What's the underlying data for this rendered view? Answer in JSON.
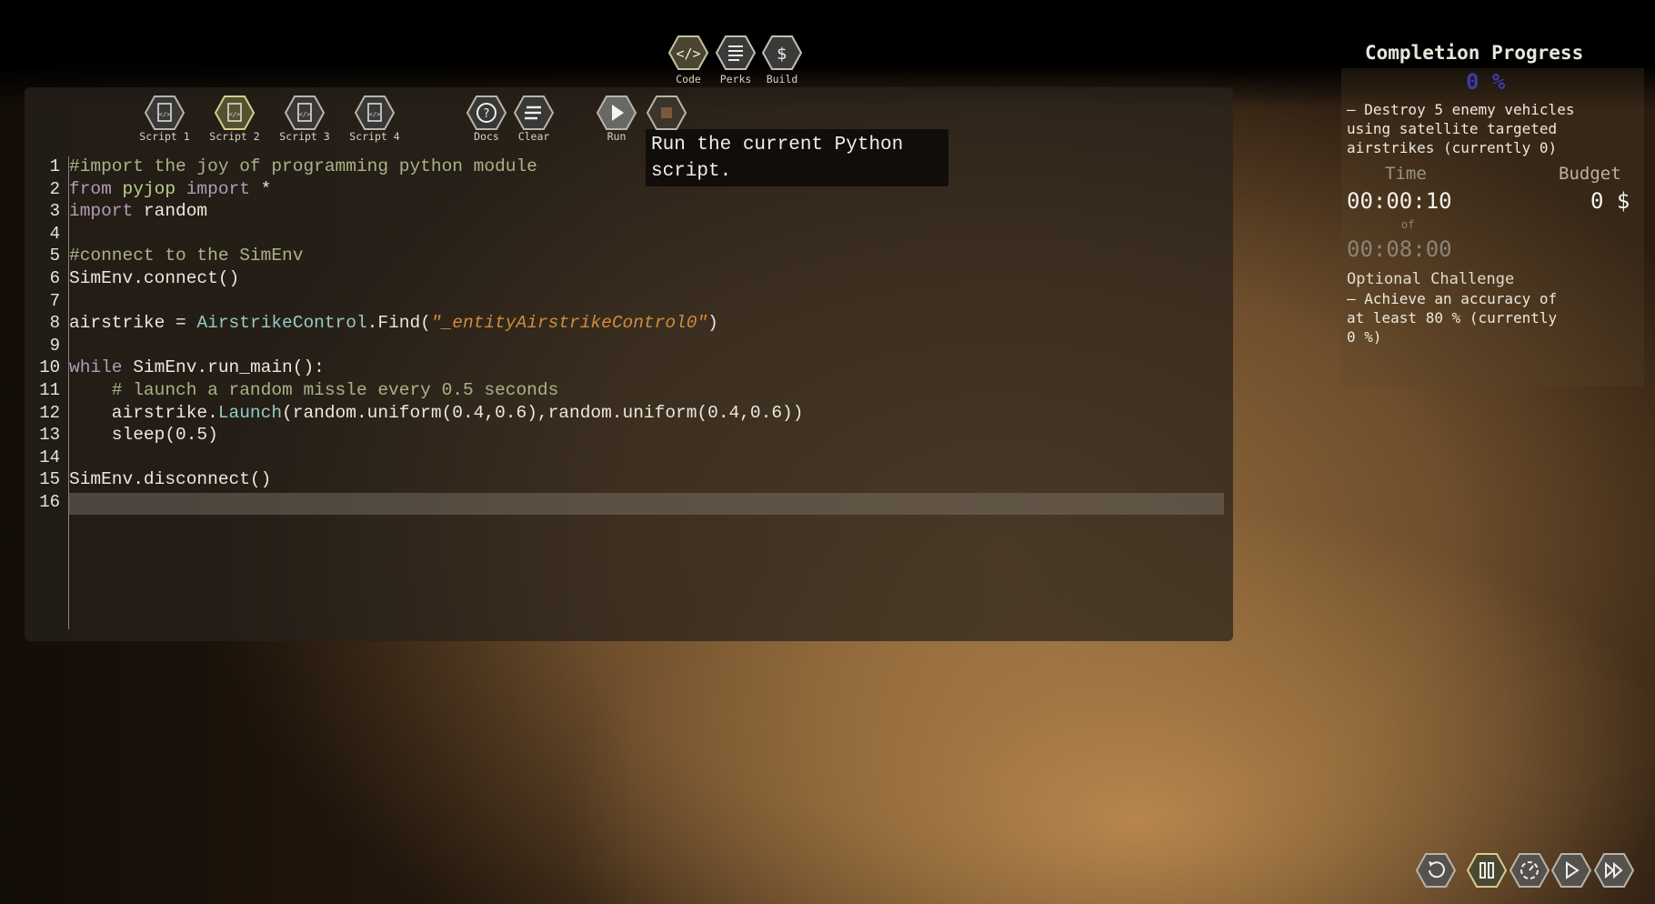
{
  "colors": {
    "accent_progress": "#3f3aa8",
    "comment": "#a9b486",
    "keyword": "#b49ab8",
    "class": "#93cbc3",
    "string": "#d08c3c"
  },
  "top_nav": [
    {
      "label": "Code",
      "icon": "code-icon"
    },
    {
      "label": "Perks",
      "icon": "list-icon"
    },
    {
      "label": "Build",
      "icon": "dollar-icon"
    }
  ],
  "toolbar": {
    "scripts": [
      {
        "label": "Script 1",
        "active": false
      },
      {
        "label": "Script 2",
        "active": true
      },
      {
        "label": "Script 3",
        "active": false
      },
      {
        "label": "Script 4",
        "active": false
      }
    ],
    "docs": "Docs",
    "clear": "Clear",
    "run": "Run",
    "stop_icon": "stop-icon"
  },
  "tooltip": "Run the current Python script.",
  "editor": {
    "line_numbers": [
      "1",
      "2",
      "3",
      "4",
      "5",
      "6",
      "7",
      "8",
      "9",
      "10",
      "11",
      "12",
      "13",
      "14",
      "15",
      "16"
    ],
    "current_line": 16,
    "lines": [
      "#import the joy of programming python module",
      "from pyjop import *",
      "import random",
      "",
      "#connect to the SimEnv",
      "SimEnv.connect()",
      "",
      "airstrike = AirstrikeControl.Find(\"_entityAirstrikeControl0\")",
      "",
      "while SimEnv.run_main():",
      "    # launch a random missle every 0.5 seconds",
      "    airstrike.Launch(random.uniform(0.4,0.6),random.uniform(0.4,0.6))",
      "    sleep(0.5)",
      "",
      "SimEnv.disconnect()",
      ""
    ]
  },
  "panel": {
    "title": "Completion Progress",
    "progress": "0 %",
    "objective": [
      "— Destroy 5 enemy vehicles",
      "using satellite targeted",
      "airstrikes (currently 0)"
    ],
    "time_label": "Time",
    "budget_label": "Budget",
    "time": "00:00:10",
    "of": "of",
    "time_limit": "00:08:00",
    "budget": "0 $",
    "challenge_title": "Optional Challenge",
    "challenge": [
      "— Achieve an accuracy of",
      "at least 80 % (currently",
      "0 %)"
    ]
  },
  "playback": [
    {
      "icon": "restart-icon"
    },
    {
      "icon": "pause-icon",
      "active": true
    },
    {
      "icon": "slow-motion-icon"
    },
    {
      "icon": "play-icon"
    },
    {
      "icon": "fast-forward-icon"
    }
  ]
}
